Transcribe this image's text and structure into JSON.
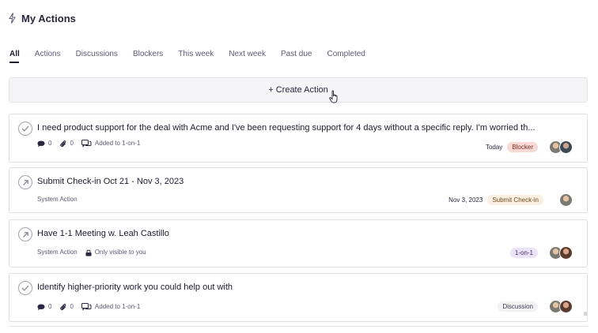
{
  "header": {
    "title": "My Actions",
    "icon": "bolt-icon"
  },
  "tabs": [
    {
      "label": "All",
      "active": true
    },
    {
      "label": "Actions",
      "active": false
    },
    {
      "label": "Discussions",
      "active": false
    },
    {
      "label": "Blockers",
      "active": false
    },
    {
      "label": "This week",
      "active": false
    },
    {
      "label": "Next week",
      "active": false
    },
    {
      "label": "Past due",
      "active": false
    },
    {
      "label": "Completed",
      "active": false
    }
  ],
  "create_action": {
    "label": "+ Create Action"
  },
  "cards": [
    {
      "title": "I need product support for the deal with Acme and I've been requesting support for 4 days without a specific reply. I'm worried th...",
      "comments": "0",
      "attachments": "0",
      "added_to": "Added to 1-on-1",
      "date": "Today",
      "badge": "Blocker"
    },
    {
      "title": "Submit Check-in Oct 21 - Nov 3, 2023",
      "source": "System Action",
      "date": "Nov 3, 2023",
      "badge": "Submit Check-in"
    },
    {
      "title": "Have 1-1 Meeting w. Leah Castillo",
      "source": "System Action",
      "visibility": "Only visible to you",
      "badge": "1-on-1"
    },
    {
      "title": "Identify higher-priority work you could help out with",
      "comments": "0",
      "attachments": "0",
      "added_to": "Added to 1-on-1",
      "badge": "Discussion"
    }
  ],
  "colors": {
    "text": "#2b2640",
    "blocker_bg": "#f8d9d4",
    "checkin_bg": "#faefe1",
    "one_on_one_bg": "#ebe3f7",
    "discussion_bg": "#f2f2f4"
  }
}
